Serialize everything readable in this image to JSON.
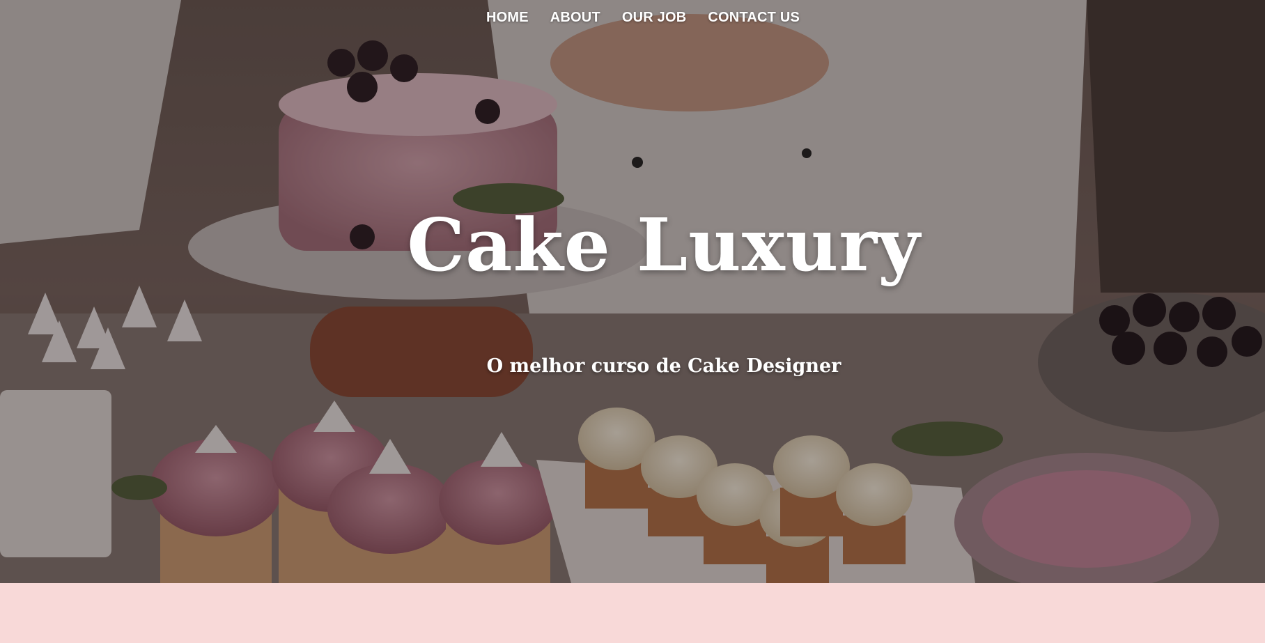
{
  "nav": {
    "items": [
      {
        "label": "HOME"
      },
      {
        "label": "ABOUT"
      },
      {
        "label": "OUR JOB"
      },
      {
        "label": "CONTACT US"
      }
    ]
  },
  "hero": {
    "title": "Cake Luxury",
    "subtitle": "O melhor curso de Cake Designer",
    "image": "pastry-chef-decorating-cake-photo"
  },
  "colors": {
    "below_background": "#f8d9d8",
    "text": "#ffffff"
  }
}
